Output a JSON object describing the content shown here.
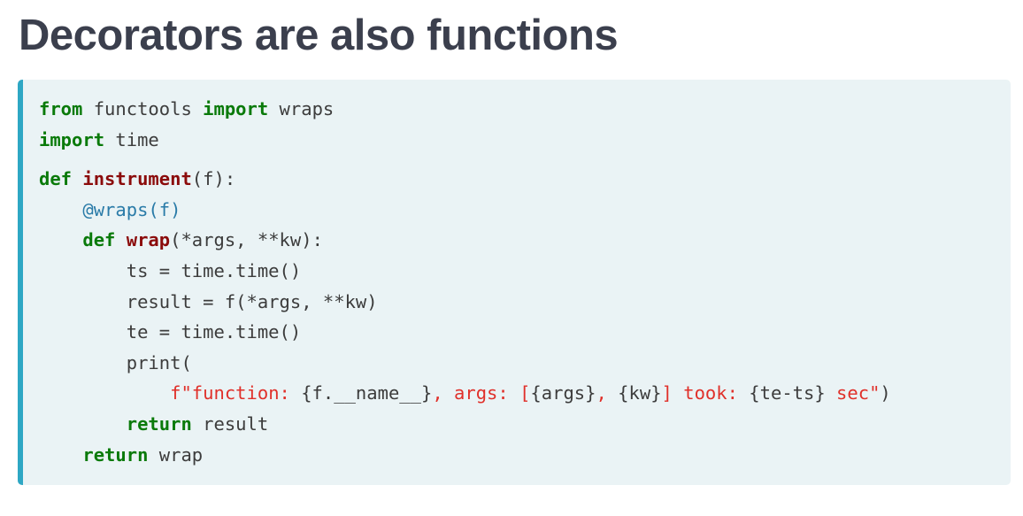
{
  "title": "Decorators are also functions",
  "code": {
    "l1": [
      "from",
      " functools ",
      "import",
      " wraps"
    ],
    "l2": [
      "import",
      " time"
    ],
    "l3": [
      "def",
      " ",
      "instrument",
      "(f):"
    ],
    "l4": [
      "    ",
      "@wraps(f)"
    ],
    "l5": [
      "    ",
      "def",
      " ",
      "wrap",
      "(*args, **kw):"
    ],
    "l6": [
      "        ts = time.time()"
    ],
    "l7": [
      "        result = f(*args, **kw)"
    ],
    "l8": [
      "        te = time.time()"
    ],
    "l9": [
      "        print("
    ],
    "l10": [
      "            ",
      "f\"function: ",
      "{f.__name__}",
      ", args: [",
      "{args}",
      ", ",
      "{kw}",
      "] took: ",
      "{te-ts}",
      " sec\"",
      ")"
    ],
    "l11": [
      "        ",
      "return",
      " result"
    ],
    "l12": [
      "    ",
      "return",
      " wrap"
    ]
  }
}
